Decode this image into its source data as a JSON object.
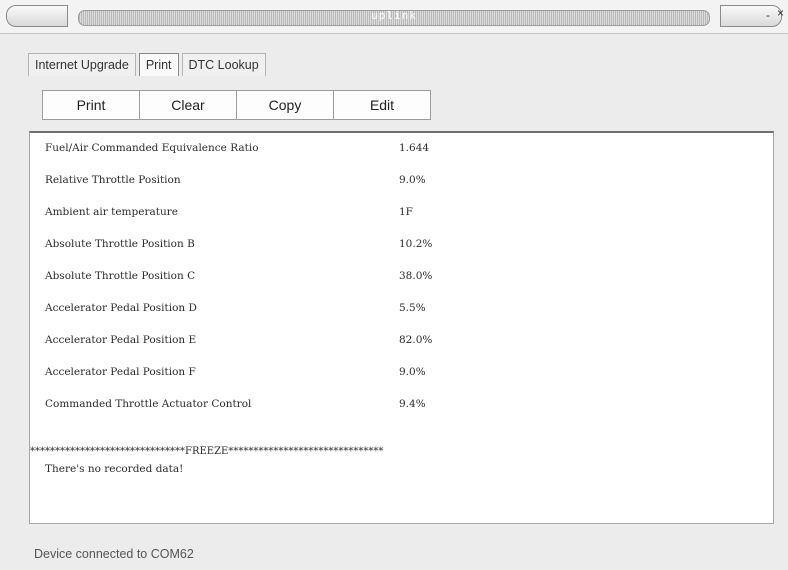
{
  "window": {
    "title": "uplink",
    "minimize_glyph": "-",
    "close_glyph": "×"
  },
  "tabs": [
    {
      "label": "Internet Upgrade",
      "active": false
    },
    {
      "label": "Print",
      "active": true
    },
    {
      "label": "DTC Lookup",
      "active": false
    }
  ],
  "toolbar": {
    "print_label": "Print",
    "clear_label": "Clear",
    "copy_label": "Copy",
    "edit_label": "Edit"
  },
  "data_rows": [
    {
      "name": "Fuel/Air Commanded Equivalence Ratio",
      "value": "1.644"
    },
    {
      "name": "Relative Throttle Position",
      "value": "9.0%"
    },
    {
      "name": "Ambient air temperature",
      "value": "1F"
    },
    {
      "name": "Absolute Throttle Position B",
      "value": "10.2%"
    },
    {
      "name": "Absolute Throttle Position C",
      "value": "38.0%"
    },
    {
      "name": "Accelerator Pedal Position D",
      "value": "5.5%"
    },
    {
      "name": "Accelerator Pedal Position E",
      "value": "82.0%"
    },
    {
      "name": "Accelerator Pedal Position F",
      "value": "9.0%"
    },
    {
      "name": "Commanded Throttle Actuator Control",
      "value": "9.4%"
    }
  ],
  "freeze_header": "*******************************FREEZE*******************************",
  "no_data_message": "There's no recorded data!",
  "status": "Device connected to COM62"
}
